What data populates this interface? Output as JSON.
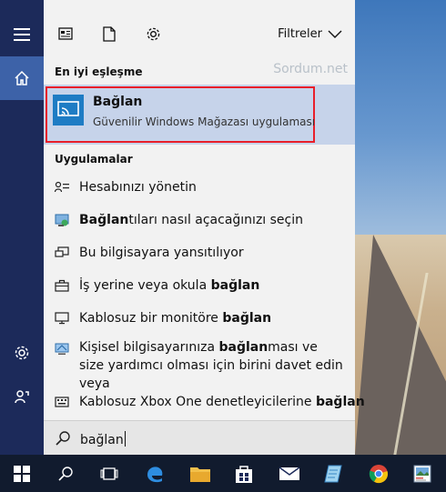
{
  "toolbar": {
    "filters_label": "Filtreler",
    "icons": [
      "news-icon",
      "document-icon",
      "gear-icon"
    ]
  },
  "watermark": "Sordum.net",
  "best_match": {
    "section_title": "En iyi eşleşme",
    "app_title": "Bağlan",
    "app_subtitle": "Güvenilir Windows Mağazası uygulaması"
  },
  "apps": {
    "section_title": "Uygulamalar",
    "items": [
      {
        "pre": "Hesabınızı yönetin",
        "bold": "",
        "post": ""
      },
      {
        "pre": "",
        "bold": "Bağlan",
        "post": "tıları nasıl açacağınızı seçin"
      },
      {
        "pre": "Bu bilgisayara yansıtılıyor",
        "bold": "",
        "post": ""
      },
      {
        "pre": "İş yerine veya okula ",
        "bold": "bağlan",
        "post": ""
      },
      {
        "pre": "Kablosuz bir monitöre ",
        "bold": "bağlan",
        "post": ""
      },
      {
        "pre": "Kişisel bilgisayarınıza ",
        "bold": "bağlan",
        "post": "ması ve size yardımcı olması için birini davet edin veya"
      },
      {
        "pre": "Kablosuz Xbox One denetleyicilerine ",
        "bold": "bağlan",
        "post": ""
      }
    ]
  },
  "search": {
    "query": "bağlan"
  },
  "colors": {
    "rail": "#1c2a5a",
    "rail_active": "#3d62a8",
    "panel": "#f2f2f2",
    "best_match_bg": "#c6d3ea",
    "highlight_border": "#e81f2a",
    "taskbar": "#111b2e"
  }
}
